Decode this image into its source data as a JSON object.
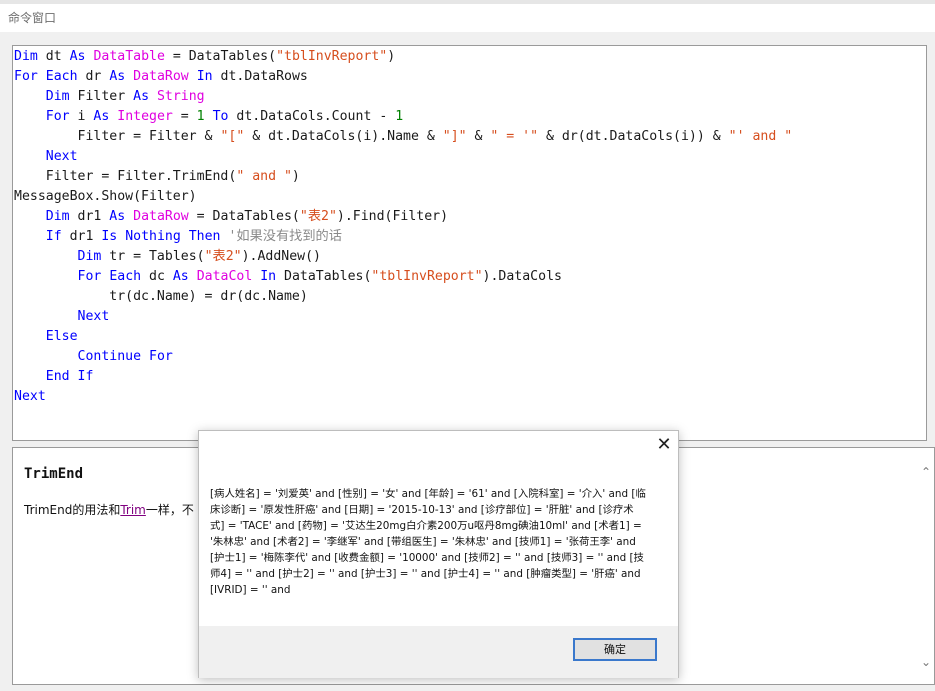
{
  "window": {
    "title": "命令窗口"
  },
  "editor": {
    "lines": [
      [
        {
          "t": "Dim",
          "c": "kw"
        },
        {
          "t": " dt "
        },
        {
          "t": "As",
          "c": "kw"
        },
        {
          "t": " "
        },
        {
          "t": "DataTable",
          "c": "ty"
        },
        {
          "t": " = DataTables("
        },
        {
          "t": "\"tblInvReport\"",
          "c": "st"
        },
        {
          "t": ")"
        }
      ],
      [
        {
          "t": "For",
          "c": "kw"
        },
        {
          "t": " "
        },
        {
          "t": "Each",
          "c": "kw"
        },
        {
          "t": " dr "
        },
        {
          "t": "As",
          "c": "kw"
        },
        {
          "t": " "
        },
        {
          "t": "DataRow",
          "c": "ty"
        },
        {
          "t": " "
        },
        {
          "t": "In",
          "c": "kw"
        },
        {
          "t": " dt.DataRows"
        }
      ],
      [
        {
          "t": "    "
        },
        {
          "t": "Dim",
          "c": "kw"
        },
        {
          "t": " Filter "
        },
        {
          "t": "As",
          "c": "kw"
        },
        {
          "t": " "
        },
        {
          "t": "String",
          "c": "ty"
        }
      ],
      [
        {
          "t": "    "
        },
        {
          "t": "For",
          "c": "kw"
        },
        {
          "t": " i "
        },
        {
          "t": "As",
          "c": "kw"
        },
        {
          "t": " "
        },
        {
          "t": "Integer",
          "c": "ty"
        },
        {
          "t": " = "
        },
        {
          "t": "1",
          "c": "nu"
        },
        {
          "t": " "
        },
        {
          "t": "To",
          "c": "kw"
        },
        {
          "t": " dt.DataCols.Count - "
        },
        {
          "t": "1",
          "c": "nu"
        }
      ],
      [
        {
          "t": "        Filter = Filter & "
        },
        {
          "t": "\"[\"",
          "c": "st"
        },
        {
          "t": " & dt.DataCols(i).Name & "
        },
        {
          "t": "\"]\"",
          "c": "st"
        },
        {
          "t": " & "
        },
        {
          "t": "\" = '\"",
          "c": "st"
        },
        {
          "t": " & dr(dt.DataCols(i)) & "
        },
        {
          "t": "\"' and \"",
          "c": "st"
        }
      ],
      [
        {
          "t": "    "
        },
        {
          "t": "Next",
          "c": "kw"
        }
      ],
      [
        {
          "t": "    Filter = Filter.TrimEnd("
        },
        {
          "t": "\" and \"",
          "c": "st"
        },
        {
          "t": ")"
        }
      ],
      [
        {
          "t": "MessageBox.Show(Filter)"
        }
      ],
      [
        {
          "t": "    "
        },
        {
          "t": "Dim",
          "c": "kw"
        },
        {
          "t": " dr1 "
        },
        {
          "t": "As",
          "c": "kw"
        },
        {
          "t": " "
        },
        {
          "t": "DataRow",
          "c": "ty"
        },
        {
          "t": " = DataTables("
        },
        {
          "t": "\"表2\"",
          "c": "st"
        },
        {
          "t": ").Find(Filter)"
        }
      ],
      [
        {
          "t": "    "
        },
        {
          "t": "If",
          "c": "kw"
        },
        {
          "t": " dr1 "
        },
        {
          "t": "Is",
          "c": "kw"
        },
        {
          "t": " "
        },
        {
          "t": "Nothing",
          "c": "kw"
        },
        {
          "t": " "
        },
        {
          "t": "Then",
          "c": "kw"
        },
        {
          "t": " "
        },
        {
          "t": "'如果没有找到的话",
          "c": "cm"
        }
      ],
      [
        {
          "t": "        "
        },
        {
          "t": "Dim",
          "c": "kw"
        },
        {
          "t": " tr = Tables("
        },
        {
          "t": "\"表2\"",
          "c": "st"
        },
        {
          "t": ").AddNew()"
        }
      ],
      [
        {
          "t": "        "
        },
        {
          "t": "For",
          "c": "kw"
        },
        {
          "t": " "
        },
        {
          "t": "Each",
          "c": "kw"
        },
        {
          "t": " dc "
        },
        {
          "t": "As",
          "c": "kw"
        },
        {
          "t": " "
        },
        {
          "t": "DataCol",
          "c": "ty"
        },
        {
          "t": " "
        },
        {
          "t": "In",
          "c": "kw"
        },
        {
          "t": " DataTables("
        },
        {
          "t": "\"tblInvReport\"",
          "c": "st"
        },
        {
          "t": ").DataCols"
        }
      ],
      [
        {
          "t": "            tr(dc.Name) = dr(dc.Name)"
        }
      ],
      [
        {
          "t": "        "
        },
        {
          "t": "Next",
          "c": "kw"
        }
      ],
      [
        {
          "t": "    "
        },
        {
          "t": "Else",
          "c": "kw"
        }
      ],
      [
        {
          "t": "        "
        },
        {
          "t": "Continue",
          "c": "kw"
        },
        {
          "t": " "
        },
        {
          "t": "For",
          "c": "kw"
        }
      ],
      [
        {
          "t": "    "
        },
        {
          "t": "End",
          "c": "kw"
        },
        {
          "t": " "
        },
        {
          "t": "If",
          "c": "kw"
        }
      ],
      [
        {
          "t": "Next",
          "c": "kw"
        }
      ]
    ]
  },
  "help": {
    "title": "TrimEnd",
    "text_prefix": "TrimEnd的用法和",
    "link": "Trim",
    "text_suffix": "一样，不"
  },
  "dialog": {
    "message": "[病人姓名] = '刘爱英' and [性别] = '女' and [年龄] = '61' and [入院科室] = '介入' and [临床诊断] = '原发性肝癌' and [日期] = '2015-10-13' and [诊疗部位] = '肝脏' and [诊疗术式] = 'TACE' and [药物] = '艾达生20mg白介素200万u呕丹8mg碘油10ml' and [术者1] = '朱林忠' and [术者2] = '李继军' and [带组医生] = '朱林忠' and [技师1] = '张荷王李' and [护士1] = '梅陈李代' and [收费金额] = '10000' and [技师2] = '' and [技师3] = '' and [技师4] = '' and [护士2] = '' and [护士3] = '' and [护士4] = '' and [肿瘤类型] = '肝癌' and [IVRID] = '' and",
    "ok_label": "确定"
  }
}
